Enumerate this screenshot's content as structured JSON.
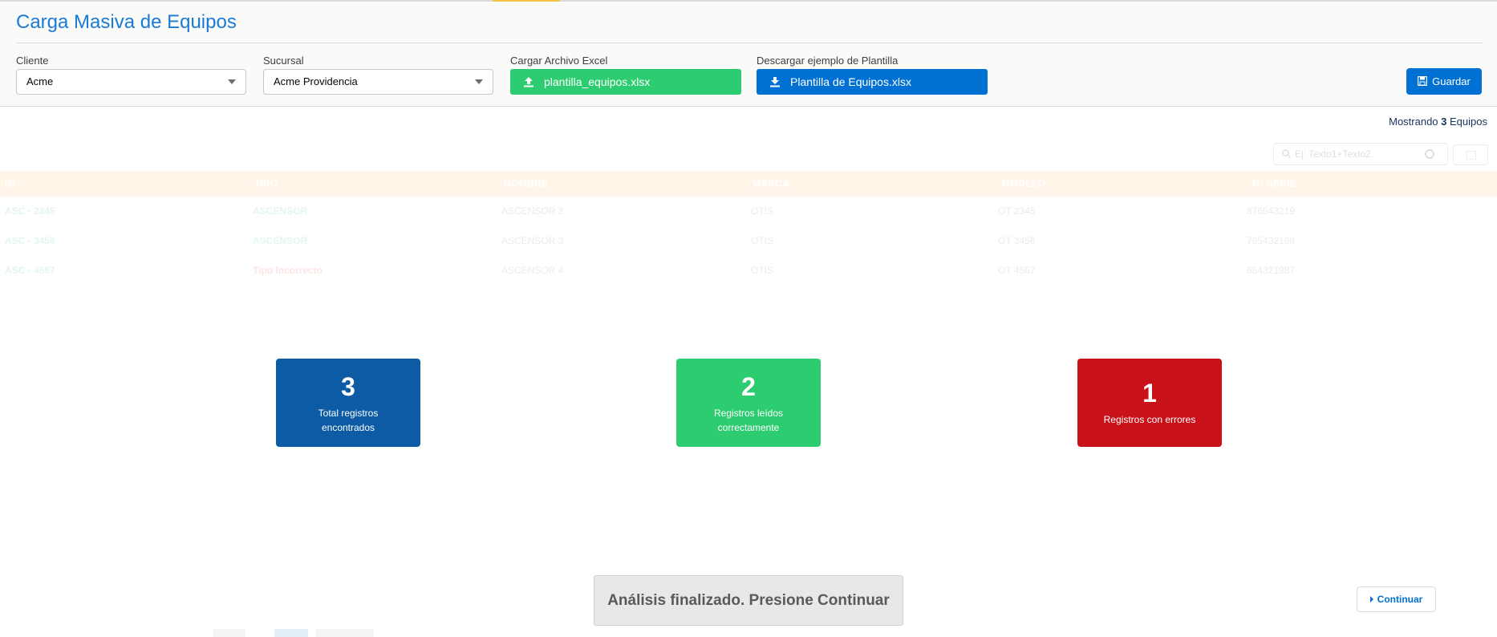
{
  "page": {
    "title": "Carga Masiva de Equipos"
  },
  "filters": {
    "cliente": {
      "label": "Cliente",
      "value": "Acme"
    },
    "sucursal": {
      "label": "Sucursal",
      "value": "Acme Providencia"
    },
    "upload": {
      "label": "Cargar Archivo Excel",
      "file": "plantilla_equipos.xlsx"
    },
    "template": {
      "label": "Descargar ejemplo de Plantilla",
      "file": "Plantilla de Equipos.xlsx"
    }
  },
  "toolbar": {
    "save_label": "Guardar"
  },
  "summary": {
    "prefix": "Mostrando",
    "count": "3",
    "suffix": "Equipos"
  },
  "search": {
    "placeholder": "Ej: Texto1+Texto2"
  },
  "table": {
    "columns": [
      "ID",
      "TIPO",
      "NOMBRE",
      "MARCA",
      "MODELO",
      "Nº SERIE"
    ],
    "rows": [
      {
        "id": "ASC - 2345",
        "tipo": "ASCENSOR",
        "nombre": "ASCENSOR 2",
        "marca": "OTIS",
        "modelo": "OT 2345",
        "serie": "876543219"
      },
      {
        "id": "ASC - 3456",
        "tipo": "ASCENSOR",
        "nombre": "ASCENSOR 3",
        "marca": "OTIS",
        "modelo": "OT 3456",
        "serie": "765432198"
      },
      {
        "id": "ASC - 4567",
        "tipo": "Tipo Incorrecto",
        "nombre": "ASCENSOR 4",
        "marca": "OTIS",
        "modelo": "OT 4567",
        "serie": "654321987"
      }
    ]
  },
  "stats": [
    {
      "value": "3",
      "label": "Total registros encontrados"
    },
    {
      "value": "2",
      "label": "Registros leídos correctamente"
    },
    {
      "value": "1",
      "label": "Registros con errores"
    }
  ],
  "status": {
    "message": "Análisis finalizado. Presione Continuar"
  },
  "actions": {
    "continue_label": "Continuar"
  },
  "colors": {
    "brand_blue": "#0070d2",
    "title_blue": "#1b7bd4",
    "success_green": "#2ecc71",
    "error_red": "#c9111a",
    "dark_blue": "#0c5ba4"
  }
}
